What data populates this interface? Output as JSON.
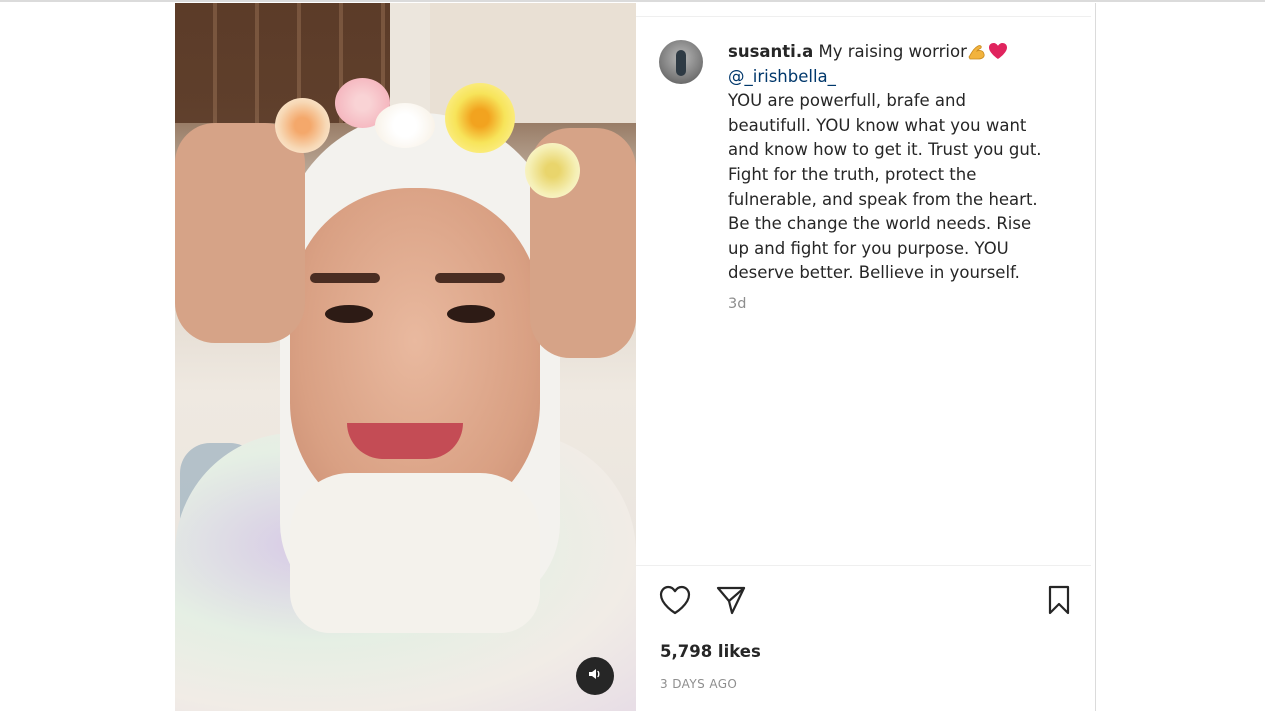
{
  "post": {
    "username": "susanti.a",
    "caption_intro": " My raising worrior",
    "mention": "@_irishbella_",
    "caption_body": "YOU are powerfull, brafe and\nbeautifull. YOU know what you want\nand know how to get it. Trust you gut.\nFight for the truth, protect the\nfulnerable, and speak from the heart.\nBe the change the world needs. Rise\nup and fight for you purpose. YOU\ndeserve better. Bellieve in yourself.",
    "relative_age": "3d",
    "likes": "5,798 likes",
    "timestamp": "3 DAYS AGO"
  },
  "icons": {
    "avatar": "user-avatar",
    "emoji_1": "flexed-biceps-emoji",
    "emoji_2": "red-heart-emoji",
    "sound": "speaker-icon",
    "like": "heart-outline-icon",
    "share": "paper-plane-icon",
    "save": "bookmark-outline-icon"
  },
  "colors": {
    "text": "#262626",
    "muted": "#8e8e8e",
    "link": "#00376b",
    "border": "#dbdbdb",
    "heart": "#e0245e",
    "biceps": "#f2b33d"
  }
}
